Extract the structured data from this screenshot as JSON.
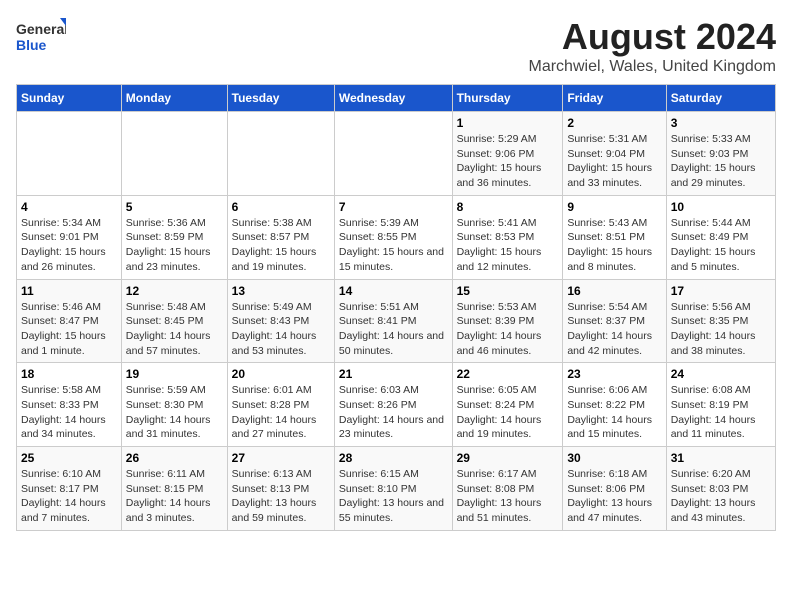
{
  "logo": {
    "general": "General",
    "blue": "Blue"
  },
  "title": "August 2024",
  "subtitle": "Marchwiel, Wales, United Kingdom",
  "days_of_week": [
    "Sunday",
    "Monday",
    "Tuesday",
    "Wednesday",
    "Thursday",
    "Friday",
    "Saturday"
  ],
  "weeks": [
    [
      {
        "day": "",
        "sunrise": "",
        "sunset": "",
        "daylight": ""
      },
      {
        "day": "",
        "sunrise": "",
        "sunset": "",
        "daylight": ""
      },
      {
        "day": "",
        "sunrise": "",
        "sunset": "",
        "daylight": ""
      },
      {
        "day": "",
        "sunrise": "",
        "sunset": "",
        "daylight": ""
      },
      {
        "day": "1",
        "sunrise": "Sunrise: 5:29 AM",
        "sunset": "Sunset: 9:06 PM",
        "daylight": "Daylight: 15 hours and 36 minutes."
      },
      {
        "day": "2",
        "sunrise": "Sunrise: 5:31 AM",
        "sunset": "Sunset: 9:04 PM",
        "daylight": "Daylight: 15 hours and 33 minutes."
      },
      {
        "day": "3",
        "sunrise": "Sunrise: 5:33 AM",
        "sunset": "Sunset: 9:03 PM",
        "daylight": "Daylight: 15 hours and 29 minutes."
      }
    ],
    [
      {
        "day": "4",
        "sunrise": "Sunrise: 5:34 AM",
        "sunset": "Sunset: 9:01 PM",
        "daylight": "Daylight: 15 hours and 26 minutes."
      },
      {
        "day": "5",
        "sunrise": "Sunrise: 5:36 AM",
        "sunset": "Sunset: 8:59 PM",
        "daylight": "Daylight: 15 hours and 23 minutes."
      },
      {
        "day": "6",
        "sunrise": "Sunrise: 5:38 AM",
        "sunset": "Sunset: 8:57 PM",
        "daylight": "Daylight: 15 hours and 19 minutes."
      },
      {
        "day": "7",
        "sunrise": "Sunrise: 5:39 AM",
        "sunset": "Sunset: 8:55 PM",
        "daylight": "Daylight: 15 hours and 15 minutes."
      },
      {
        "day": "8",
        "sunrise": "Sunrise: 5:41 AM",
        "sunset": "Sunset: 8:53 PM",
        "daylight": "Daylight: 15 hours and 12 minutes."
      },
      {
        "day": "9",
        "sunrise": "Sunrise: 5:43 AM",
        "sunset": "Sunset: 8:51 PM",
        "daylight": "Daylight: 15 hours and 8 minutes."
      },
      {
        "day": "10",
        "sunrise": "Sunrise: 5:44 AM",
        "sunset": "Sunset: 8:49 PM",
        "daylight": "Daylight: 15 hours and 5 minutes."
      }
    ],
    [
      {
        "day": "11",
        "sunrise": "Sunrise: 5:46 AM",
        "sunset": "Sunset: 8:47 PM",
        "daylight": "Daylight: 15 hours and 1 minute."
      },
      {
        "day": "12",
        "sunrise": "Sunrise: 5:48 AM",
        "sunset": "Sunset: 8:45 PM",
        "daylight": "Daylight: 14 hours and 57 minutes."
      },
      {
        "day": "13",
        "sunrise": "Sunrise: 5:49 AM",
        "sunset": "Sunset: 8:43 PM",
        "daylight": "Daylight: 14 hours and 53 minutes."
      },
      {
        "day": "14",
        "sunrise": "Sunrise: 5:51 AM",
        "sunset": "Sunset: 8:41 PM",
        "daylight": "Daylight: 14 hours and 50 minutes."
      },
      {
        "day": "15",
        "sunrise": "Sunrise: 5:53 AM",
        "sunset": "Sunset: 8:39 PM",
        "daylight": "Daylight: 14 hours and 46 minutes."
      },
      {
        "day": "16",
        "sunrise": "Sunrise: 5:54 AM",
        "sunset": "Sunset: 8:37 PM",
        "daylight": "Daylight: 14 hours and 42 minutes."
      },
      {
        "day": "17",
        "sunrise": "Sunrise: 5:56 AM",
        "sunset": "Sunset: 8:35 PM",
        "daylight": "Daylight: 14 hours and 38 minutes."
      }
    ],
    [
      {
        "day": "18",
        "sunrise": "Sunrise: 5:58 AM",
        "sunset": "Sunset: 8:33 PM",
        "daylight": "Daylight: 14 hours and 34 minutes."
      },
      {
        "day": "19",
        "sunrise": "Sunrise: 5:59 AM",
        "sunset": "Sunset: 8:30 PM",
        "daylight": "Daylight: 14 hours and 31 minutes."
      },
      {
        "day": "20",
        "sunrise": "Sunrise: 6:01 AM",
        "sunset": "Sunset: 8:28 PM",
        "daylight": "Daylight: 14 hours and 27 minutes."
      },
      {
        "day": "21",
        "sunrise": "Sunrise: 6:03 AM",
        "sunset": "Sunset: 8:26 PM",
        "daylight": "Daylight: 14 hours and 23 minutes."
      },
      {
        "day": "22",
        "sunrise": "Sunrise: 6:05 AM",
        "sunset": "Sunset: 8:24 PM",
        "daylight": "Daylight: 14 hours and 19 minutes."
      },
      {
        "day": "23",
        "sunrise": "Sunrise: 6:06 AM",
        "sunset": "Sunset: 8:22 PM",
        "daylight": "Daylight: 14 hours and 15 minutes."
      },
      {
        "day": "24",
        "sunrise": "Sunrise: 6:08 AM",
        "sunset": "Sunset: 8:19 PM",
        "daylight": "Daylight: 14 hours and 11 minutes."
      }
    ],
    [
      {
        "day": "25",
        "sunrise": "Sunrise: 6:10 AM",
        "sunset": "Sunset: 8:17 PM",
        "daylight": "Daylight: 14 hours and 7 minutes."
      },
      {
        "day": "26",
        "sunrise": "Sunrise: 6:11 AM",
        "sunset": "Sunset: 8:15 PM",
        "daylight": "Daylight: 14 hours and 3 minutes."
      },
      {
        "day": "27",
        "sunrise": "Sunrise: 6:13 AM",
        "sunset": "Sunset: 8:13 PM",
        "daylight": "Daylight: 13 hours and 59 minutes."
      },
      {
        "day": "28",
        "sunrise": "Sunrise: 6:15 AM",
        "sunset": "Sunset: 8:10 PM",
        "daylight": "Daylight: 13 hours and 55 minutes."
      },
      {
        "day": "29",
        "sunrise": "Sunrise: 6:17 AM",
        "sunset": "Sunset: 8:08 PM",
        "daylight": "Daylight: 13 hours and 51 minutes."
      },
      {
        "day": "30",
        "sunrise": "Sunrise: 6:18 AM",
        "sunset": "Sunset: 8:06 PM",
        "daylight": "Daylight: 13 hours and 47 minutes."
      },
      {
        "day": "31",
        "sunrise": "Sunrise: 6:20 AM",
        "sunset": "Sunset: 8:03 PM",
        "daylight": "Daylight: 13 hours and 43 minutes."
      }
    ]
  ]
}
